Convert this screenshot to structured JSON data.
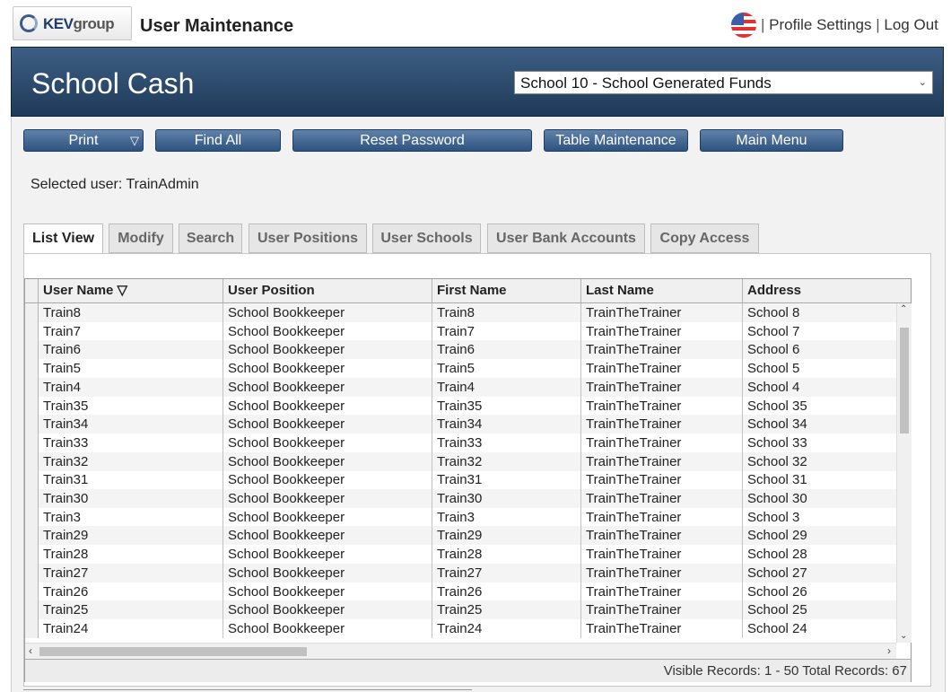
{
  "top": {
    "logo_brand": "KEV",
    "logo_group": "group",
    "title": "User Maintenance",
    "links": {
      "profile": "Profile Settings",
      "logout": "Log Out",
      "separator": "|"
    }
  },
  "header": {
    "brand": "School Cash",
    "school_select": "School 10 - School Generated Funds"
  },
  "toolbar": {
    "print": "Print",
    "print_arrow": "▽",
    "find_all": "Find All",
    "reset_password": "Reset Password",
    "table_maintenance": "Table Maintenance",
    "main_menu": "Main Menu"
  },
  "selected_user": "Selected user:  TrainAdmin",
  "tabs": [
    "List View",
    "Modify",
    "Search",
    "User Positions",
    "User Schools",
    "User Bank Accounts",
    "Copy Access"
  ],
  "grid": {
    "columns": [
      "User Name ▽",
      "User Position",
      "First Name",
      "Last Name",
      "Address"
    ],
    "rows": [
      [
        "Train8",
        "School Bookkeeper",
        "Train8",
        "TrainTheTrainer",
        "School 8"
      ],
      [
        "Train7",
        "School Bookkeeper",
        "Train7",
        "TrainTheTrainer",
        "School 7"
      ],
      [
        "Train6",
        "School Bookkeeper",
        "Train6",
        "TrainTheTrainer",
        "School 6"
      ],
      [
        "Train5",
        "School Bookkeeper",
        "Train5",
        "TrainTheTrainer",
        "School 5"
      ],
      [
        "Train4",
        "School Bookkeeper",
        "Train4",
        "TrainTheTrainer",
        "School 4"
      ],
      [
        "Train35",
        "School Bookkeeper",
        "Train35",
        "TrainTheTrainer",
        "School 35"
      ],
      [
        "Train34",
        "School Bookkeeper",
        "Train34",
        "TrainTheTrainer",
        "School 34"
      ],
      [
        "Train33",
        "School Bookkeeper",
        "Train33",
        "TrainTheTrainer",
        "School 33"
      ],
      [
        "Train32",
        "School Bookkeeper",
        "Train32",
        "TrainTheTrainer",
        "School 32"
      ],
      [
        "Train31",
        "School Bookkeeper",
        "Train31",
        "TrainTheTrainer",
        "School 31"
      ],
      [
        "Train30",
        "School Bookkeeper",
        "Train30",
        "TrainTheTrainer",
        "School 30"
      ],
      [
        "Train3",
        "School Bookkeeper",
        "Train3",
        "TrainTheTrainer",
        "School 3"
      ],
      [
        "Train29",
        "School Bookkeeper",
        "Train29",
        "TrainTheTrainer",
        "School 29"
      ],
      [
        "Train28",
        "School Bookkeeper",
        "Train28",
        "TrainTheTrainer",
        "School 28"
      ],
      [
        "Train27",
        "School Bookkeeper",
        "Train27",
        "TrainTheTrainer",
        "School 27"
      ],
      [
        "Train26",
        "School Bookkeeper",
        "Train26",
        "TrainTheTrainer",
        "School 26"
      ],
      [
        "Train25",
        "School Bookkeeper",
        "Train25",
        "TrainTheTrainer",
        "School 25"
      ],
      [
        "Train24",
        "School Bookkeeper",
        "Train24",
        "TrainTheTrainer",
        "School 24"
      ]
    ],
    "footer": "Visible Records: 1 - 50 Total Records: 67"
  },
  "colors": {
    "header_top": "#3d5f84",
    "header_bottom": "#1f3a59",
    "button": "#2f537f"
  }
}
